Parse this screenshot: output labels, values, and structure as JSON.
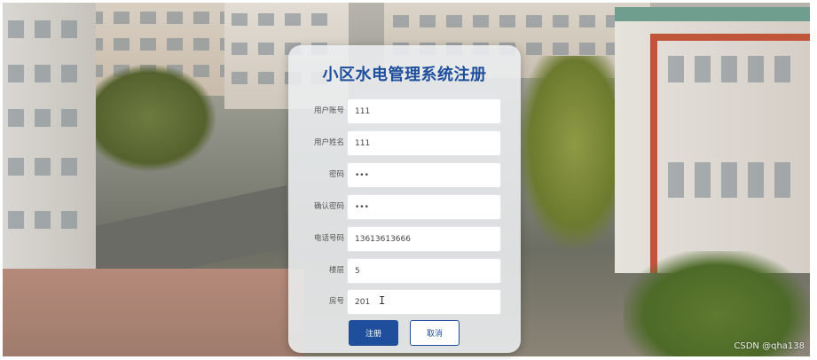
{
  "form": {
    "title": "小区水电管理系统注册",
    "fields": [
      {
        "label": "用户账号",
        "value": "111",
        "type": "text"
      },
      {
        "label": "用户姓名",
        "value": "111",
        "type": "text"
      },
      {
        "label": "密码",
        "value": "111",
        "type": "password"
      },
      {
        "label": "确认密码",
        "value": "111",
        "type": "password"
      },
      {
        "label": "电话号码",
        "value": "13613613666",
        "type": "text"
      },
      {
        "label": "楼层",
        "value": "5",
        "type": "text"
      },
      {
        "label": "房号",
        "value": "201",
        "type": "text"
      }
    ],
    "register_label": "注册",
    "cancel_label": "取消"
  },
  "watermark": "CSDN @qha138",
  "colors": {
    "title": "#1f4f9c",
    "primary_button": "#1f4f9c",
    "card_background": "#eceef0"
  },
  "icons": {
    "text_cursor": "text-cursor-icon"
  }
}
